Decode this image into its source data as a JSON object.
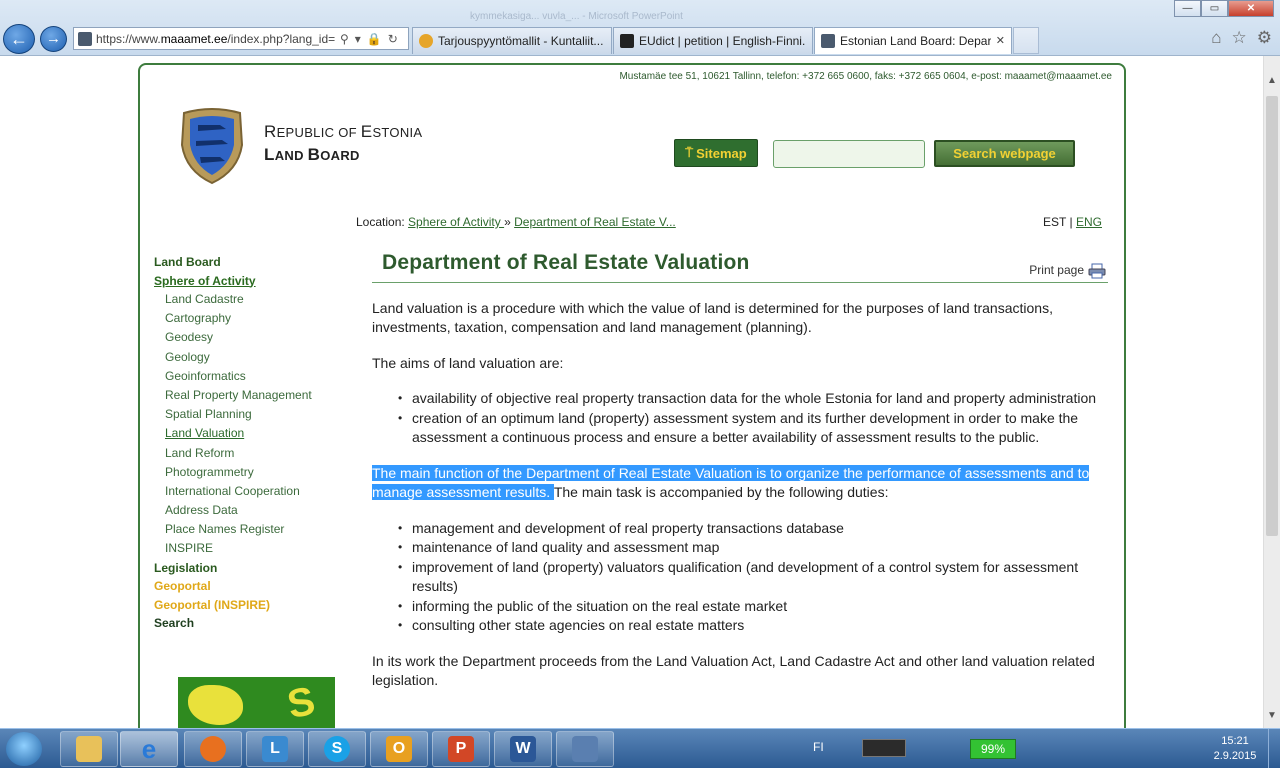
{
  "browser": {
    "window_caption": "kymmekasiga... vuvla_...  - Microsoft PowerPoint",
    "address_url_prefix": "https://www.",
    "address_url_domain": "maaamet.ee",
    "address_url_rest": "/index.php?lang_id=",
    "tabs": [
      {
        "label": "Tarjouspyyntömallit - Kuntaliit..."
      },
      {
        "label": "EUdict | petition | English-Finni..."
      },
      {
        "label": "Estonian Land Board: Depar..."
      }
    ],
    "window_controls": {
      "minimize": "—",
      "maximize": "▭",
      "close": "✕"
    }
  },
  "header": {
    "contact": "Mustamäe tee 51, 10621 Tallinn, telefon: +372 665 0600, faks: +372 665 0604, e-post: maaamet@maaamet.ee",
    "brand_line1_cap": "R",
    "brand_line1_rest": "EPUBLIC OF ",
    "brand_line1_cap2": "E",
    "brand_line1_rest2": "STONIA",
    "brand_line2_cap": "L",
    "brand_line2_rest": "AND ",
    "brand_line2_cap2": "B",
    "brand_line2_rest2": "OARD",
    "sitemap_label": "Sitemap",
    "search_button": "Search webpage",
    "search_value": ""
  },
  "breadcrumb": {
    "prefix": "Location:",
    "item1": "Sphere of Activity ",
    "separator": "»",
    "item2": "Department of Real Estate V..."
  },
  "language": {
    "est": "EST",
    "sep": "|",
    "eng": "ENG"
  },
  "sidebar": {
    "top1": "Land Board",
    "top2": "Sphere of Activity",
    "subitems": [
      "Land Cadastre",
      "Cartography",
      "Geodesy",
      "Geology",
      "Geoinformatics",
      "Real Property Management",
      "Spatial Planning",
      "Land Valuation",
      "Land Reform",
      "Photogrammetry",
      "International Cooperation",
      "Address Data",
      "Place Names Register",
      "INSPIRE"
    ],
    "legislation": "Legislation",
    "geoportal": "Geoportal",
    "geoportal_inspire": "Geoportal (INSPIRE)",
    "search": "Search"
  },
  "main": {
    "title": "Department of Real Estate Valuation",
    "print_label": "Print page",
    "p1": "Land valuation is a procedure with which the value of land is determined for the purposes of land transactions, investments, taxation, compensation and land management (planning).",
    "p2": "The aims of land valuation are:",
    "aims": [
      "availability of objective real property transaction data for the whole Estonia for land and property administration",
      "creation of an optimum land (property) assessment system and its further development in order to make the assessment a continuous process and ensure a better availability of assessment results to the public."
    ],
    "p3_highlight": "The main function of the Department of Real Estate Valuation is to organize the performance of assessments and to manage assessment results. ",
    "p3_rest": "The main task is accompanied by the following duties:",
    "duties": [
      "management and development of real property transactions database",
      "maintenance of land quality and assessment map",
      "improvement of land (property) valuators qualification (and development of a control system for assessment results)",
      "informing the public of the situation on the real estate market",
      "consulting other state agencies on real estate matters"
    ],
    "p4": "In its work the Department proceeds from the Land Valuation Act, Land Cadastre Act and other land valuation related legislation."
  },
  "taskbar": {
    "language": "FI",
    "battery": "99%",
    "time": "15:21",
    "date": "2.9.2015"
  },
  "colors": {
    "accent_green": "#2e5a2e",
    "highlight": "#3399ff",
    "button_yellow": "#f2d133"
  }
}
